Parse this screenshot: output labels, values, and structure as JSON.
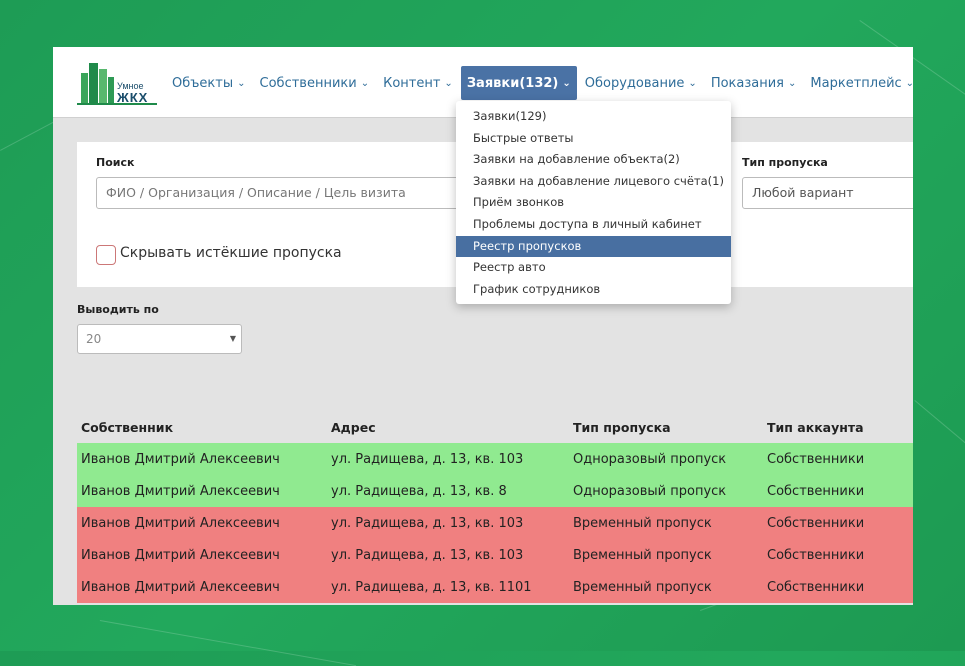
{
  "logo": {
    "line1": "Умное",
    "line2": "ЖКХ"
  },
  "nav": [
    {
      "label": "Объекты",
      "active": false
    },
    {
      "label": "Собственники",
      "active": false
    },
    {
      "label": "Контент",
      "active": false
    },
    {
      "label": "Заявки(132)",
      "active": true
    },
    {
      "label": "Оборудование",
      "active": false
    },
    {
      "label": "Показания",
      "active": false
    },
    {
      "label": "Маркетплейс",
      "active": false
    }
  ],
  "dropdown": {
    "items": [
      "Заявки(129)",
      "Быстрые ответы",
      "Заявки на добавление объекта(2)",
      "Заявки на добавление лицевого счёта(1)",
      "Приём звонков",
      "Проблемы доступа в личный кабинет",
      "Реестр пропусков",
      "Реестр авто",
      "График сотрудников"
    ],
    "selected_index": 6
  },
  "filters": {
    "search_label": "Поиск",
    "search_placeholder": "ФИО / Организация / Описание / Цель визита",
    "pass_type_label": "Тип пропуска",
    "pass_type_value": "Любой вариант",
    "hide_expired_label": "Скрывать истёкшие пропуска"
  },
  "pagination": {
    "label": "Выводить по",
    "value": "20"
  },
  "table": {
    "headers": [
      "Собственник",
      "Адрес",
      "Тип пропуска",
      "Тип аккаунта"
    ],
    "rows": [
      {
        "owner": "Иванов Дмитрий Алексеевич",
        "address": "ул. Радищева, д. 13, кв. 103",
        "pass_type": "Одноразовый пропуск",
        "account_type": "Собственники",
        "status": "green"
      },
      {
        "owner": "Иванов Дмитрий Алексеевич",
        "address": "ул. Радищева, д. 13, кв. 8",
        "pass_type": "Одноразовый пропуск",
        "account_type": "Собственники",
        "status": "green"
      },
      {
        "owner": "Иванов Дмитрий Алексеевич",
        "address": "ул. Радищева, д. 13, кв. 103",
        "pass_type": "Временный пропуск",
        "account_type": "Собственники",
        "status": "red"
      },
      {
        "owner": "Иванов Дмитрий Алексеевич",
        "address": "ул. Радищева, д. 13, кв. 103",
        "pass_type": "Временный пропуск",
        "account_type": "Собственники",
        "status": "red"
      },
      {
        "owner": "Иванов Дмитрий Алексеевич",
        "address": "ул. Радищева, д. 13, кв. 1101",
        "pass_type": "Временный пропуск",
        "account_type": "Собственники",
        "status": "red"
      }
    ]
  }
}
